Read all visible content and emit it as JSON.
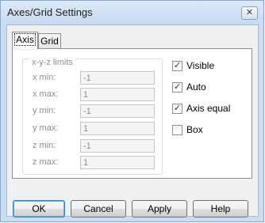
{
  "window": {
    "title": "Axes/Grid Settings"
  },
  "tabs": [
    {
      "label": "Axis"
    },
    {
      "label": "Grid"
    }
  ],
  "limits": {
    "title": "x-y-z limits",
    "rows": [
      {
        "label": "x min:",
        "value": "-1"
      },
      {
        "label": "x max:",
        "value": "1"
      },
      {
        "label": "y min:",
        "value": "-1"
      },
      {
        "label": "y max:",
        "value": "1"
      },
      {
        "label": "z min:",
        "value": "-1"
      },
      {
        "label": "z max:",
        "value": "1"
      }
    ]
  },
  "options": [
    {
      "label": "Visible",
      "checked": true
    },
    {
      "label": "Auto",
      "checked": true
    },
    {
      "label": "Axis equal",
      "checked": true
    },
    {
      "label": "Box",
      "checked": false
    }
  ],
  "buttons": {
    "ok": "OK",
    "cancel": "Cancel",
    "apply": "Apply",
    "help": "Help"
  },
  "icons": {
    "close": "close-icon",
    "check": "checkmark-icon"
  }
}
